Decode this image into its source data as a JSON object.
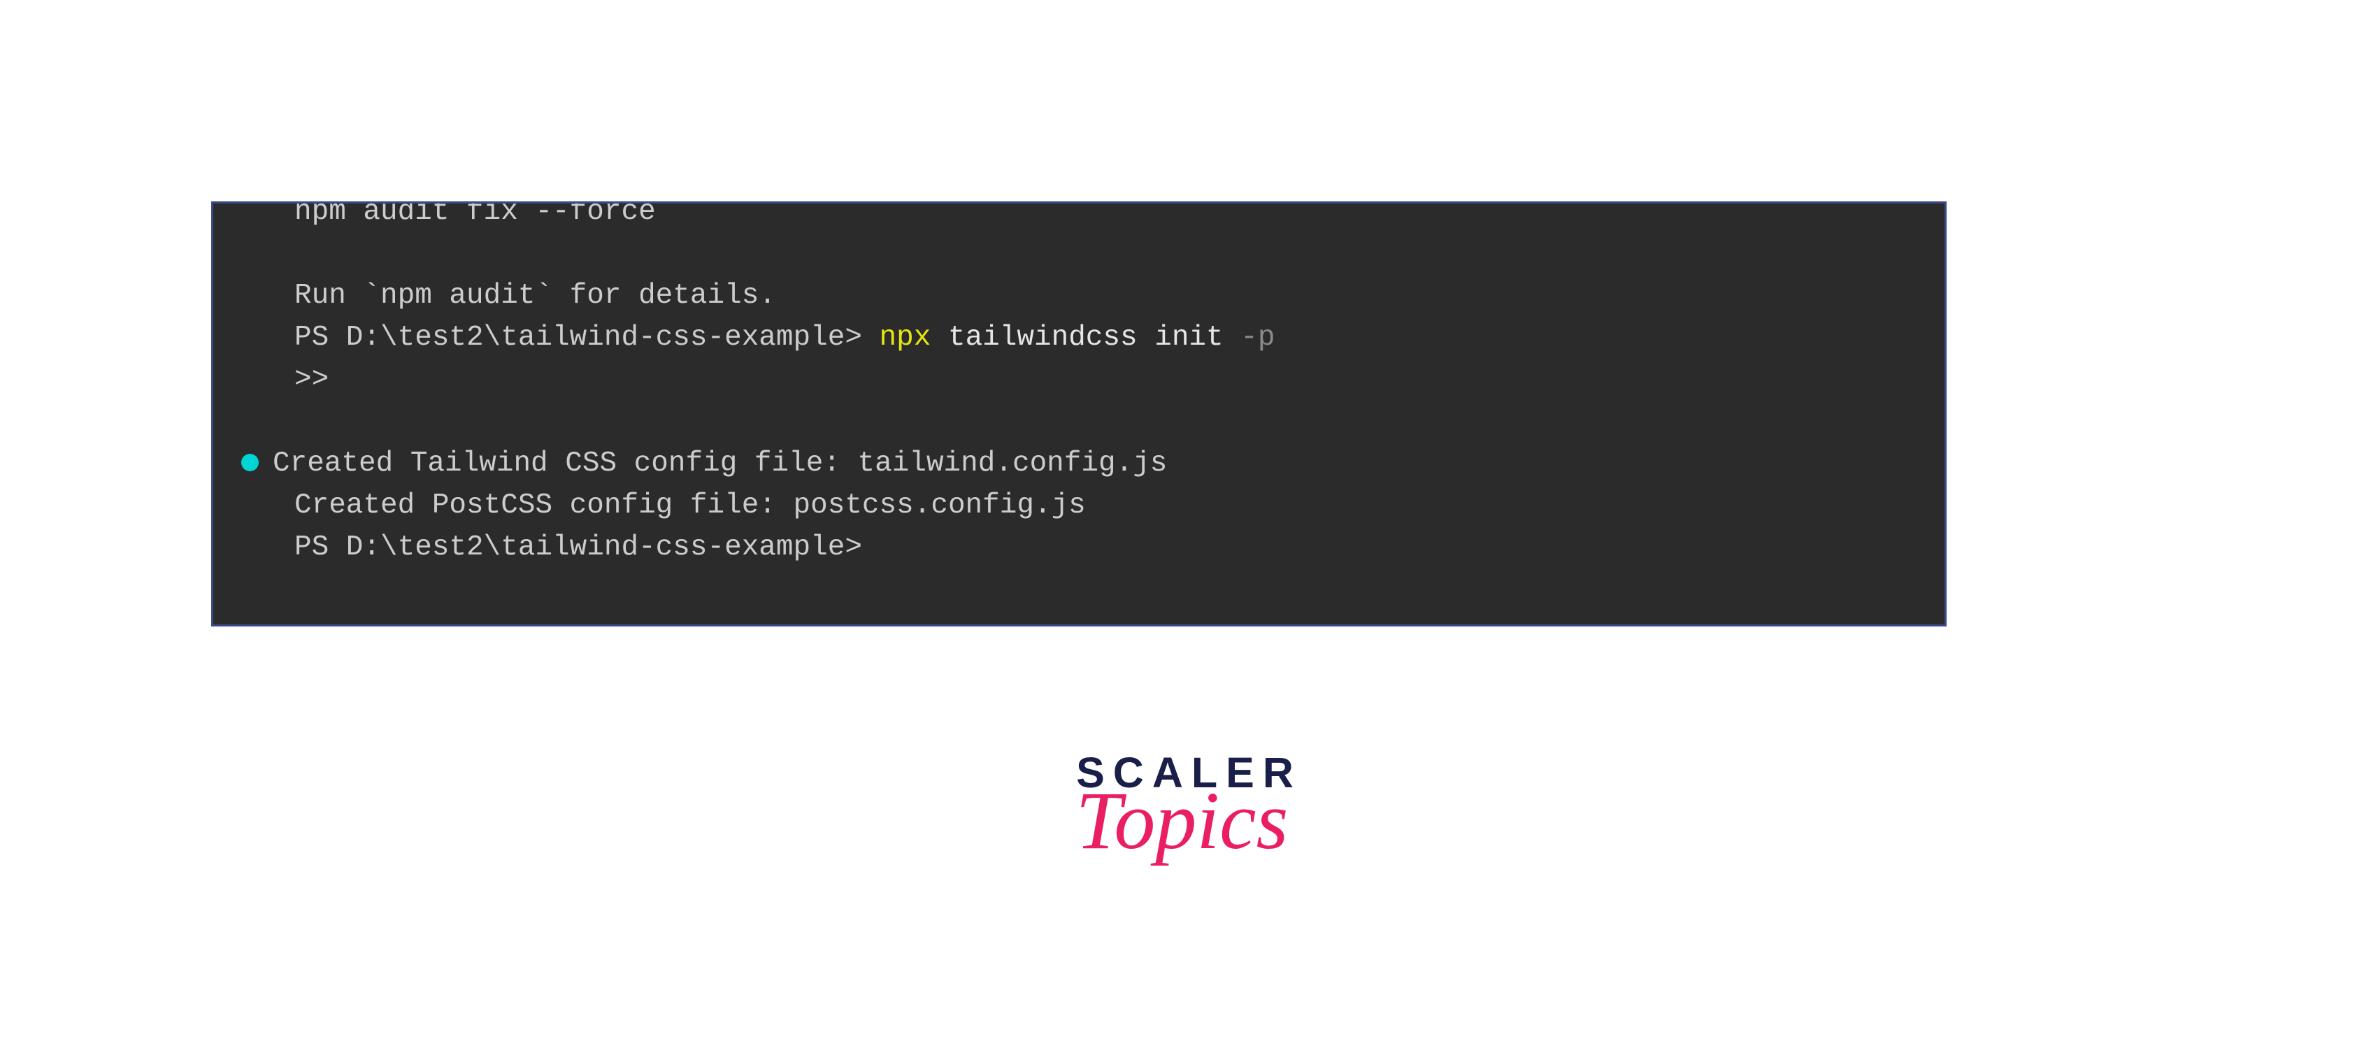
{
  "terminal": {
    "lines": {
      "partial_top": "npm audit fix --force",
      "audit_msg": "Run `npm audit` for details.",
      "prompt1_path": "PS D:\\test2\\tailwind-css-example> ",
      "cmd_npx": "npx",
      "cmd_args": " tailwindcss init ",
      "cmd_flag": "-p",
      "continuation": ">>",
      "created_tailwind": "Created Tailwind CSS config file: tailwind.config.js",
      "created_postcss": "Created PostCSS config file: postcss.config.js",
      "prompt2_path": "PS D:\\test2\\tailwind-css-example>"
    }
  },
  "logo": {
    "scaler": "SCALER",
    "topics": "Topics"
  }
}
